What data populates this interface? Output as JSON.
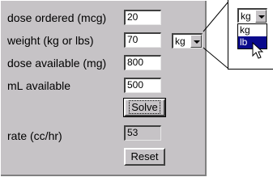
{
  "form": {
    "dose_ordered_label": "dose ordered (mcg)",
    "dose_ordered_value": "20",
    "weight_label": "weight (kg or lbs)",
    "weight_value": "70",
    "weight_unit": "kg",
    "dose_available_label": "dose available (mg)",
    "dose_available_value": "800",
    "ml_available_label": "mL available",
    "ml_available_value": "500",
    "solve_label": "Solve",
    "rate_label": "rate (cc/hr)",
    "rate_value": "53",
    "reset_label": "Reset"
  },
  "zoom_callout": {
    "selected": "kg",
    "options": [
      "kg",
      "lb"
    ],
    "highlighted": "lb"
  }
}
